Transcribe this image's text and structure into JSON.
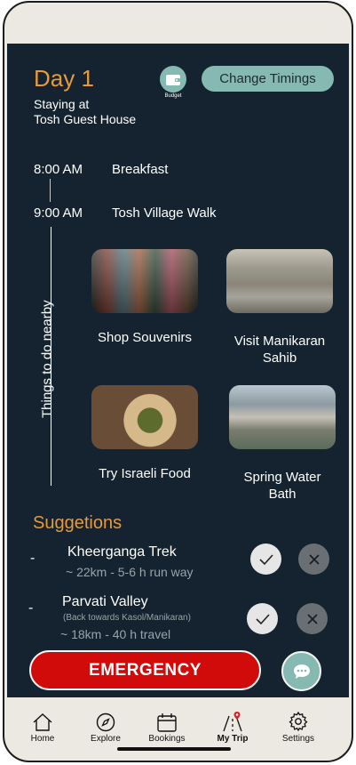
{
  "header": {
    "day_title": "Day 1",
    "staying_line1": "Staying at",
    "staying_line2": "Tosh Guest House",
    "budget_label": "Budget",
    "change_timings_label": "Change Timings"
  },
  "schedule": [
    {
      "time": "8:00 AM",
      "activity": "Breakfast"
    },
    {
      "time": "9:00 AM",
      "activity": "Tosh Village Walk"
    }
  ],
  "nearby": {
    "label": "Things to do nearby",
    "items": [
      {
        "title": "Shop Souvenirs",
        "image": "souvenir-market-photo"
      },
      {
        "title_line1": "Visit Manikaran",
        "title_line2": "Sahib",
        "image": "manikaran-gurudwara-photo"
      },
      {
        "title": "Try Israeli Food",
        "image": "israeli-food-photo"
      },
      {
        "title_line1": "Spring Water",
        "title_line2": "Bath",
        "image": "hot-spring-bath-photo"
      }
    ]
  },
  "suggestions": {
    "title": "Suggetions",
    "items": [
      {
        "dash": "-",
        "name": "Kheerganga Trek",
        "detail": "~ 22km - 5-6 h run way"
      },
      {
        "dash": "-",
        "name": "Parvati Valley",
        "note": "(Back towards Kasol/Manikaran)",
        "detail": "~ 18km - 40 h travel"
      }
    ]
  },
  "actions": {
    "emergency_label": "EMERGENCY"
  },
  "nav": [
    {
      "label": "Home",
      "icon": "home-icon"
    },
    {
      "label": "Explore",
      "icon": "compass-icon"
    },
    {
      "label": "Bookings",
      "icon": "calendar-icon"
    },
    {
      "label": "My Trip",
      "icon": "route-pin-icon"
    },
    {
      "label": "Settings",
      "icon": "gear-icon"
    }
  ],
  "colors": {
    "background": "#14232f",
    "accent_orange": "#e69a3c",
    "accent_teal": "#86b9b1",
    "emergency_red": "#d10a0a"
  }
}
